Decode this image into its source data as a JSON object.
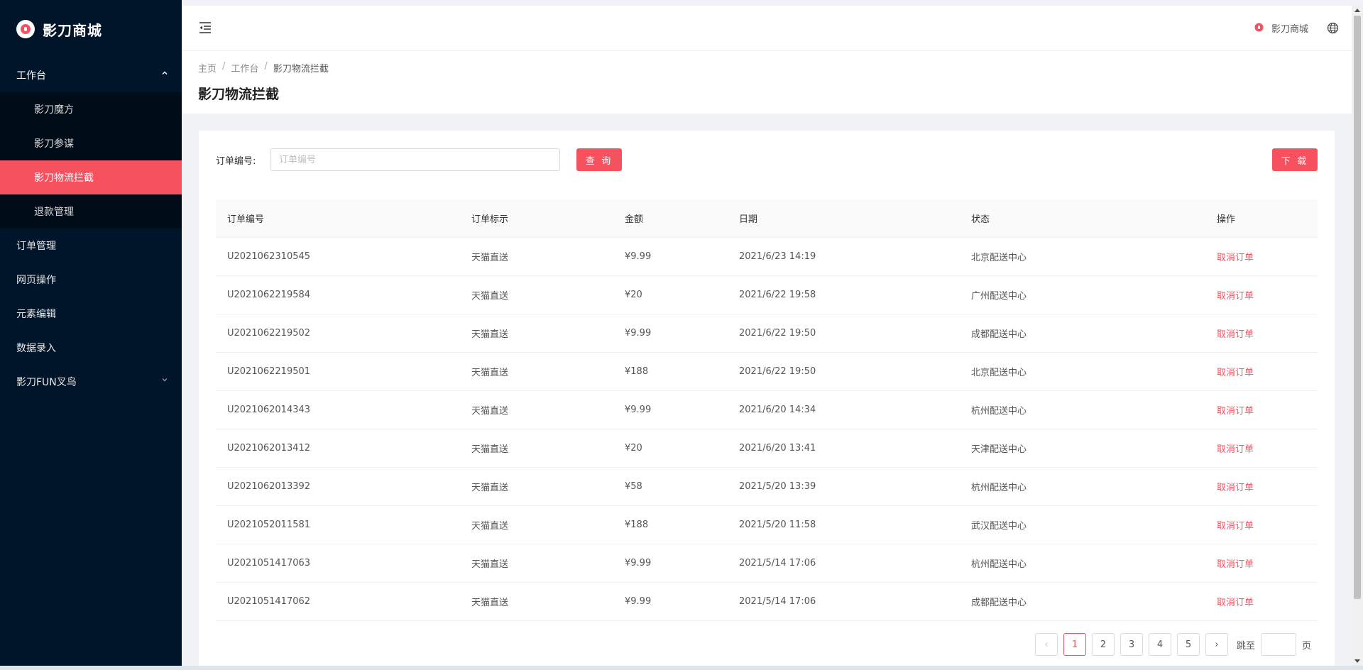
{
  "app": {
    "brand": "影刀商城"
  },
  "sidebar": {
    "workbench": "工作台",
    "sub_items": [
      {
        "label": "影刀魔方"
      },
      {
        "label": "影刀参谋"
      },
      {
        "label": "影刀物流拦截"
      },
      {
        "label": "退款管理"
      }
    ],
    "items": [
      {
        "label": "订单管理"
      },
      {
        "label": "网页操作"
      },
      {
        "label": "元素编辑"
      },
      {
        "label": "数据录入"
      },
      {
        "label": "影刀FUN叉鸟"
      }
    ]
  },
  "header": {
    "brand": "影刀商城"
  },
  "breadcrumb": {
    "home": "主页",
    "workbench": "工作台",
    "current": "影刀物流拦截"
  },
  "page": {
    "title": "影刀物流拦截"
  },
  "search": {
    "label": "订单编号:",
    "placeholder": "订单编号",
    "value": "",
    "query_button": "查 询",
    "download_button": "下 载"
  },
  "table": {
    "columns": [
      "订单编号",
      "订单标示",
      "金额",
      "日期",
      "状态",
      "操作"
    ],
    "rows": [
      {
        "id": "U2021062310545",
        "tag": "天猫直送",
        "amount": "¥9.99",
        "date": "2021/6/23 14:19",
        "status": "北京配送中心",
        "action": "取消订单"
      },
      {
        "id": "U2021062219584",
        "tag": "天猫直送",
        "amount": "¥20",
        "date": "2021/6/22 19:58",
        "status": "广州配送中心",
        "action": "取消订单"
      },
      {
        "id": "U2021062219502",
        "tag": "天猫直送",
        "amount": "¥9.99",
        "date": "2021/6/22 19:50",
        "status": "成都配送中心",
        "action": "取消订单"
      },
      {
        "id": "U2021062219501",
        "tag": "天猫直送",
        "amount": "¥188",
        "date": "2021/6/22 19:50",
        "status": "北京配送中心",
        "action": "取消订单"
      },
      {
        "id": "U2021062014343",
        "tag": "天猫直送",
        "amount": "¥9.99",
        "date": "2021/6/20 14:34",
        "status": "杭州配送中心",
        "action": "取消订单"
      },
      {
        "id": "U2021062013412",
        "tag": "天猫直送",
        "amount": "¥20",
        "date": "2021/6/20 13:41",
        "status": "天津配送中心",
        "action": "取消订单"
      },
      {
        "id": "U2021062013392",
        "tag": "天猫直送",
        "amount": "¥58",
        "date": "2021/5/20 13:39",
        "status": "杭州配送中心",
        "action": "取消订单"
      },
      {
        "id": "U2021052011581",
        "tag": "天猫直送",
        "amount": "¥188",
        "date": "2021/5/20 11:58",
        "status": "武汉配送中心",
        "action": "取消订单"
      },
      {
        "id": "U2021051417063",
        "tag": "天猫直送",
        "amount": "¥9.99",
        "date": "2021/5/14 17:06",
        "status": "杭州配送中心",
        "action": "取消订单"
      },
      {
        "id": "U2021051417062",
        "tag": "天猫直送",
        "amount": "¥9.99",
        "date": "2021/5/14 17:06",
        "status": "成都配送中心",
        "action": "取消订单"
      }
    ]
  },
  "pagination": {
    "prev": "‹",
    "next": "›",
    "pages": [
      "1",
      "2",
      "3",
      "4",
      "5"
    ],
    "current": "1",
    "jump_label": "跳至",
    "jump_suffix": "页"
  },
  "colors": {
    "accent": "#f5515f",
    "sidebar_bg": "#001529",
    "submenu_bg": "#000c17"
  },
  "icons": {
    "logo": "yingdao-logo-icon",
    "fold": "menu-fold-icon",
    "globe": "globe-icon",
    "chevron_up": "chevron-up-icon",
    "chevron_down": "chevron-down-icon"
  }
}
